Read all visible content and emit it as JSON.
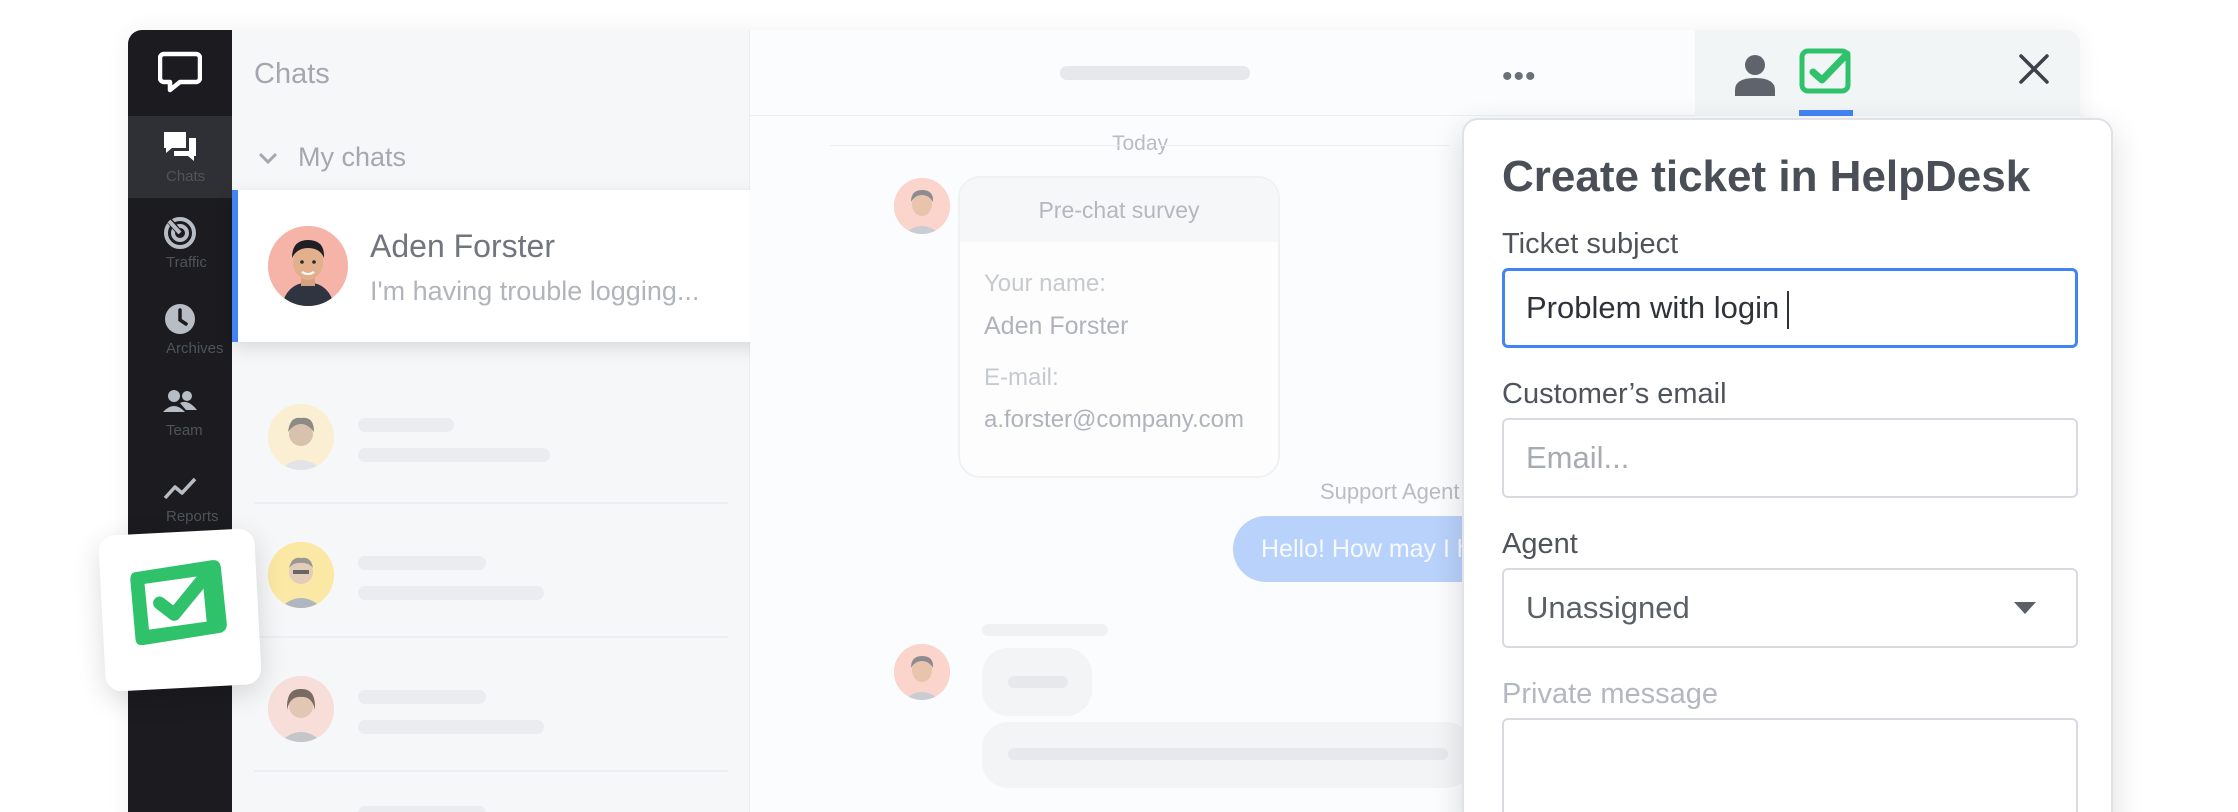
{
  "sidebar": {
    "items": [
      {
        "label": "Chats",
        "icon": "chats-icon",
        "active": true
      },
      {
        "label": "Traffic",
        "icon": "traffic-icon",
        "active": false
      },
      {
        "label": "Archives",
        "icon": "archives-icon",
        "active": false
      },
      {
        "label": "Team",
        "icon": "team-icon",
        "active": false
      },
      {
        "label": "Reports",
        "icon": "reports-icon",
        "active": false
      }
    ]
  },
  "chat_list": {
    "title": "Chats",
    "section": "My chats",
    "active_chat": {
      "name": "Aden Forster",
      "preview": "I'm having trouble logging..."
    }
  },
  "conversation": {
    "date_divider": "Today",
    "survey": {
      "title": "Pre-chat survey",
      "name_label": "Your name:",
      "name_value": "Aden Forster",
      "email_label": "E-mail:",
      "email_value": "a.forster@company.com"
    },
    "agent_label": "Support Agent",
    "agent_message": "Hello! How may I help you?"
  },
  "helpdesk_form": {
    "title": "Create ticket in HelpDesk",
    "subject_label": "Ticket subject",
    "subject_value": "Problem with login",
    "email_label": "Customer’s email",
    "email_placeholder": "Email...",
    "agent_label": "Agent",
    "agent_value": "Unassigned",
    "message_label": "Private message"
  },
  "colors": {
    "accent": "#4384f5",
    "helpdesk_green": "#2fc26b",
    "sidebar_bg": "#1b1b20"
  }
}
